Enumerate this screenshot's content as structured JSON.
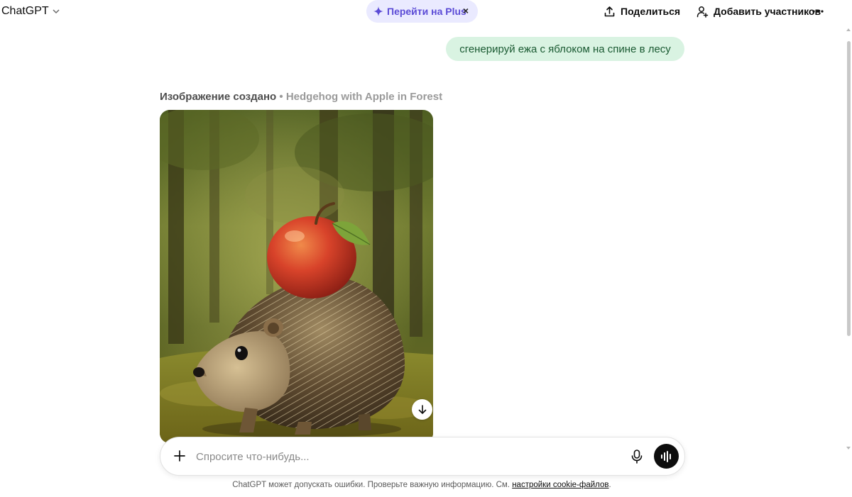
{
  "header": {
    "model_name": "ChatGPT",
    "upgrade_label": "Перейти на Plus",
    "share_label": "Поделиться",
    "add_participants_label": "Добавить участников"
  },
  "conversation": {
    "user_message": "сгенерируй ежа с яблоком на спине в лесу",
    "assistant": {
      "status_label": "Изображение создано",
      "separator": "•",
      "image_title": "Hedgehog with Apple in Forest"
    }
  },
  "composer": {
    "placeholder": "Спросите что-нибудь..."
  },
  "footer": {
    "disclaimer": "ChatGPT может допускать ошибки. Проверьте важную информацию. См.",
    "cookie_link": "настройки cookie-файлов",
    "end_punct": "."
  },
  "icons": {
    "model_dropdown": "chevron-down-icon",
    "upgrade": "sparkle-icon",
    "dismiss": "close-icon",
    "share": "upload-icon",
    "add_participants": "add-user-icon",
    "more": "more-horizontal-icon",
    "download": "download-icon",
    "attach": "plus-icon",
    "dictate": "microphone-icon",
    "voice_mode": "voice-wave-icon"
  },
  "colors": {
    "user_bubble_bg": "#d9f3e2",
    "user_bubble_text": "#1a5a32",
    "upgrade_pill_bg": "#eaeaff",
    "upgrade_pill_text": "#5b4bd6",
    "voice_button_bg": "#0d0d0d"
  }
}
